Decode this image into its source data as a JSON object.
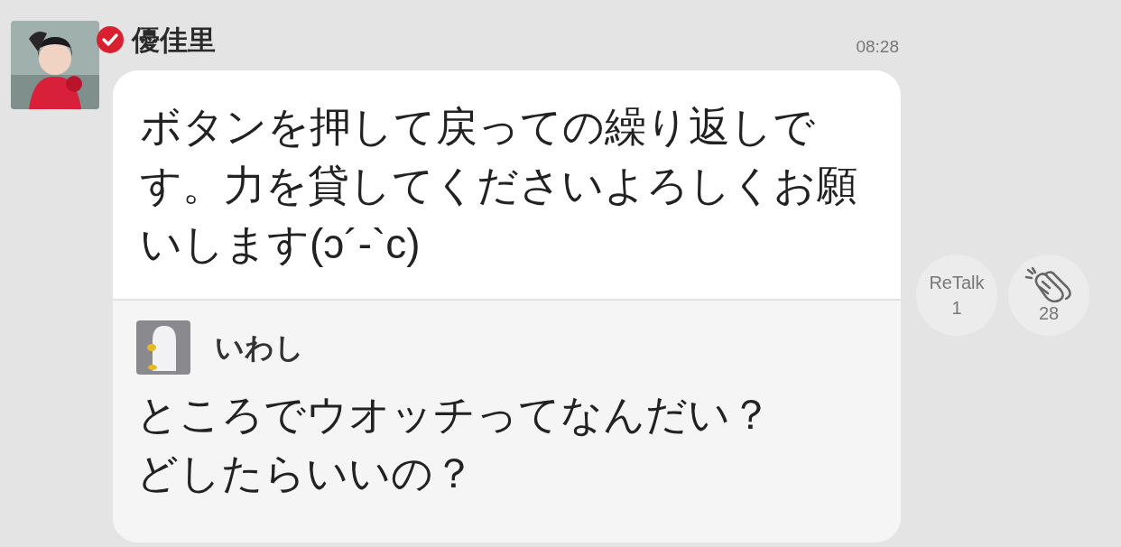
{
  "post": {
    "sender": {
      "name": "優佳里",
      "verified": true
    },
    "time": "08:28",
    "text": "ボタンを押して戻っての繰り返しです。力を貸してくださいよろしくお願いします(ɔ´-`c)",
    "quote": {
      "name": "いわし",
      "lines": [
        "ところでウオッチってなんだい？",
        "どしたらいいの？"
      ]
    }
  },
  "actions": [
    {
      "kind": "retalk",
      "label": "ReTalk",
      "count": "1"
    },
    {
      "kind": "clap",
      "count": "28"
    }
  ]
}
